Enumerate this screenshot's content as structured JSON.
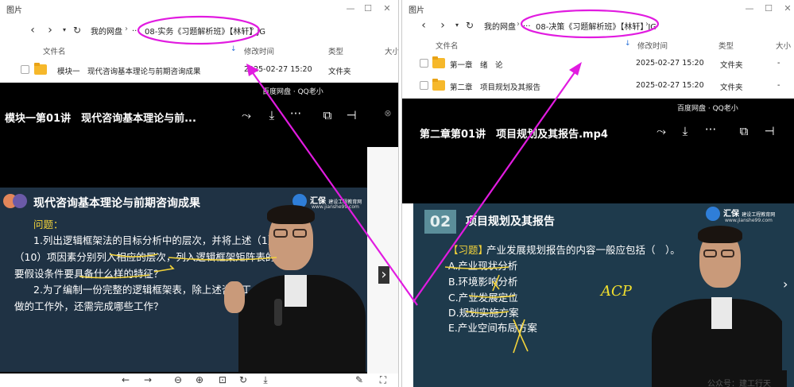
{
  "left_window": {
    "title": "图片",
    "breadcrumb_root": "我的网盘",
    "breadcrumb_ellipsis": "...",
    "breadcrumb_current": "08-实务《习题解析班》【林轩】JG",
    "columns": {
      "name": "文件名",
      "mtime": "修改时间",
      "type": "类型",
      "size": "大小"
    },
    "files": [
      {
        "name": "模块一　现代咨询基本理论与前期咨询成果",
        "mtime": "2025-02-27 15:20",
        "type": "文件夹"
      }
    ]
  },
  "right_window": {
    "title": "图片",
    "breadcrumb_root": "我的网盘",
    "breadcrumb_ellipsis": "...",
    "breadcrumb_current": "08-决策《习题解析班》【林轩】JG",
    "columns": {
      "name": "文件名",
      "mtime": "修改时间",
      "type": "类型",
      "size": "大小"
    },
    "files": [
      {
        "name": "第一章　绪　论",
        "mtime": "2025-02-27 15:20",
        "type": "文件夹",
        "size": "-"
      },
      {
        "name": "第二章　项目规划及其报告",
        "mtime": "2025-02-27 15:20",
        "type": "文件夹",
        "size": "-"
      }
    ]
  },
  "left_player": {
    "source": "百度网盘 · QQ老小",
    "title": "模块一第01讲　现代咨询基本理论与前...",
    "slide": {
      "heading": "现代咨询基本理论与前期咨询成果",
      "brand": "汇保",
      "brand_small": "建设工程教育网",
      "brand_url": "www.jianshe99.com",
      "lines": [
        "问题：",
        "1.列出逻辑框架法的目标分析中的层次，并将上述（1）",
        "（10）项因素分别列入相应的层次，列入逻辑框架矩阵表的重",
        "要假设条件要具备什么样的特征？",
        "2.为了编制一份完整的逻辑框架表，除上述咨询工",
        "做的工作外，还需完成哪些工作？"
      ]
    }
  },
  "right_player": {
    "source": "百度网盘 · QQ老小",
    "title": "第二章第01讲　项目规划及其报告.mp4",
    "slide": {
      "number": "02",
      "heading": "项目规划及其报告",
      "brand": "汇保",
      "brand_small": "建设工程教育网",
      "brand_url": "www.jianshe99.com",
      "question_tag": "【习题】",
      "question": "产业发展规划报告的内容一般应包括（　）。",
      "options": [
        "A.产业现状分析",
        "B.环境影响分析",
        "C.产业发展定位",
        "D.规划实施方案",
        "E.产业空间布局方案"
      ],
      "handwriting": "ACP"
    }
  },
  "watermark": "公众号：建工行天",
  "colors": {
    "annotation": "#e11be0",
    "slide_bg": "#1f3244",
    "highlight_yellow": "#f3d33a"
  }
}
